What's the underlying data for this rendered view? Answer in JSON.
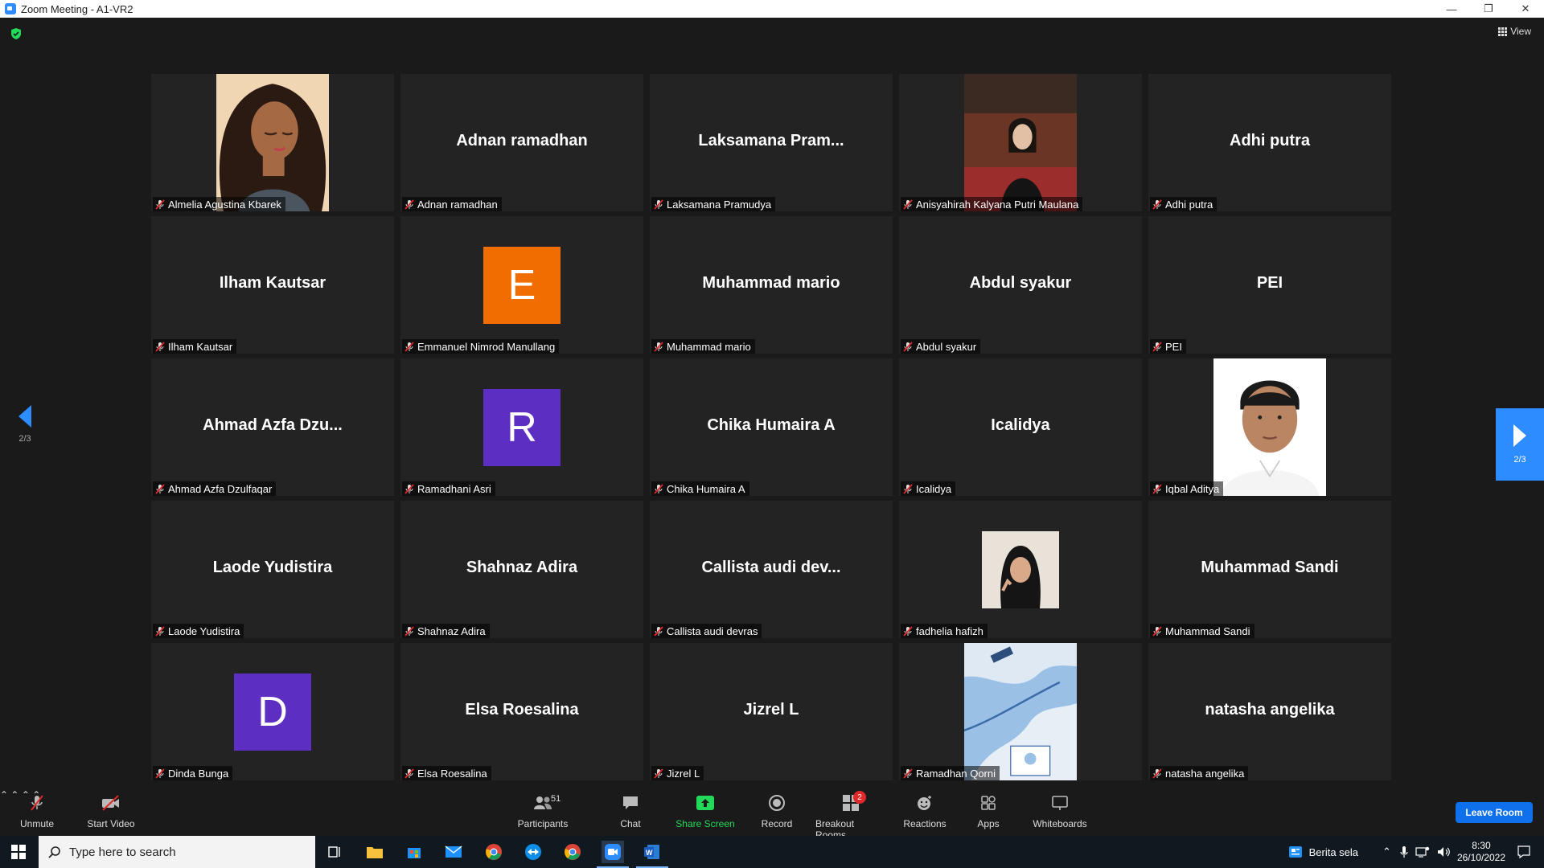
{
  "window": {
    "title": "Zoom Meeting - A1-VR2",
    "minimize": "—",
    "restore": "❐",
    "close": "✕"
  },
  "top_bar": {
    "view_label": "View"
  },
  "pager": {
    "left_page": "2/3",
    "right_page": "2/3"
  },
  "tiles": [
    {
      "kind": "photo",
      "photo": "woman-curly-hair-illustration",
      "label": "Almelia Agustina Kbarek"
    },
    {
      "kind": "name",
      "display": "Adnan ramadhan",
      "label": "Adnan ramadhan"
    },
    {
      "kind": "name",
      "display": "Laksamana  Pram...",
      "label": "Laksamana Pramudya"
    },
    {
      "kind": "photo",
      "photo": "woman-in-office-portrait",
      "label": "Anisyahirah Kalyana Putri Maulana"
    },
    {
      "kind": "name",
      "display": "Adhi putra",
      "label": "Adhi putra"
    },
    {
      "kind": "name",
      "display": "Ilham Kautsar",
      "label": "Ilham Kautsar"
    },
    {
      "kind": "avatar",
      "letter": "E",
      "color": "#f26d00",
      "label": "Emmanuel Nimrod Manullang"
    },
    {
      "kind": "name",
      "display": "Muhammad mario",
      "label": "Muhammad mario"
    },
    {
      "kind": "name",
      "display": "Abdul syakur",
      "label": "Abdul syakur"
    },
    {
      "kind": "name",
      "display": "PEI",
      "label": "PEI"
    },
    {
      "kind": "name",
      "display": "Ahmad  Azfa  Dzu...",
      "label": "Ahmad Azfa Dzulfaqar"
    },
    {
      "kind": "avatar",
      "letter": "R",
      "color": "#5c2fc2",
      "label": "Ramadhani Asri"
    },
    {
      "kind": "name",
      "display": "Chika Humaira A",
      "label": "Chika Humaira A"
    },
    {
      "kind": "name",
      "display": "Icalidya",
      "label": "Icalidya"
    },
    {
      "kind": "photo",
      "photo": "man-white-shirt-portrait",
      "label": "Iqbal Aditya"
    },
    {
      "kind": "name",
      "display": "Laode Yudistira",
      "label": "Laode Yudistira"
    },
    {
      "kind": "name",
      "display": "Shahnaz Adira",
      "label": "Shahnaz Adira"
    },
    {
      "kind": "name",
      "display": "Callista audi dev...",
      "label": "Callista audi devras"
    },
    {
      "kind": "photo-sm",
      "photo": "woman-hijab-portrait",
      "label": "fadhelia hafizh"
    },
    {
      "kind": "name",
      "display": "Muhammad Sandi",
      "label": "Muhammad Sandi"
    },
    {
      "kind": "avatar",
      "letter": "D",
      "color": "#5c2fc2",
      "label": "Dinda Bunga"
    },
    {
      "kind": "name",
      "display": "Elsa Roesalina",
      "label": "Elsa Roesalina"
    },
    {
      "kind": "name",
      "display": "Jizrel L",
      "label": "Jizrel L"
    },
    {
      "kind": "photo",
      "photo": "map-image",
      "label": "Ramadhan Qorni"
    },
    {
      "kind": "name",
      "display": "natasha angelika",
      "label": "natasha angelika"
    }
  ],
  "toolbar": {
    "unmute": "Unmute",
    "start_video": "Start Video",
    "participants": "Participants",
    "participants_count": "51",
    "chat": "Chat",
    "share_screen": "Share Screen",
    "record": "Record",
    "breakout_rooms": "Breakout Rooms",
    "breakout_badge": "2",
    "reactions": "Reactions",
    "apps": "Apps",
    "whiteboards": "Whiteboards",
    "leave": "Leave Room"
  },
  "taskbar": {
    "search_placeholder": "Type here to search",
    "news": "Berita sela",
    "time": "8:30",
    "date": "26/10/2022"
  },
  "colors": {
    "accent": "#2d8cff",
    "share_green": "#23d959",
    "leave_blue": "#0e71eb",
    "mute_red": "#e02828"
  }
}
